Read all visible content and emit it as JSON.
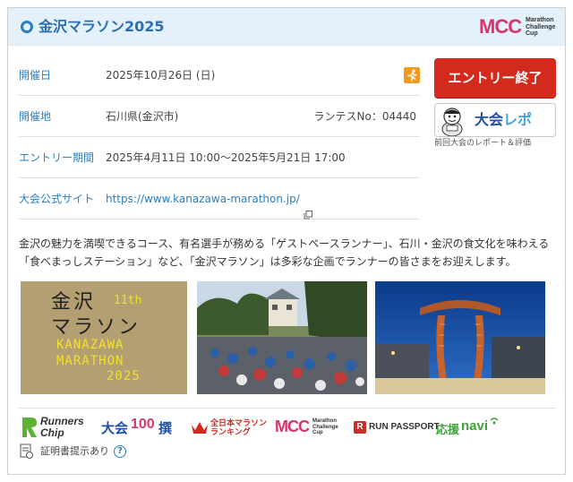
{
  "header": {
    "title": "金沢マラソン2025",
    "mcc_logo_big": "MCC",
    "mcc_logo_small": [
      "Marathon",
      "Challenge",
      "Cup"
    ]
  },
  "info": [
    {
      "label": "開催日",
      "value": "2025年10月26日 (日)",
      "icon": "runner-icon"
    },
    {
      "label": "開催地",
      "value": "石川県(金沢市)",
      "right": "ランテスNo：04440"
    },
    {
      "label": "エントリー期間",
      "value": "2025年4月11日 10:00〜2025年5月21日 17:00"
    },
    {
      "label": "大会公式サイト",
      "value": "https://www.kanazawa-marathon.jp/",
      "icon": "external-link-icon"
    }
  ],
  "entry_button": {
    "label": "エントリー終了"
  },
  "report_button": {
    "label_part1": "大会",
    "label_part2": "レポ",
    "caption": "前回大会のレポート＆評価"
  },
  "description": "金沢の魅力を満喫できるコース、有名選手が務める「ゲストペースランナー」、石川・金沢の食文化を味わえる「食べまっしステーション」など、「金沢マラソン」は多彩な企画でランナーの皆さまをお迎えします。",
  "poster": {
    "ja_line1": "金沢",
    "ja_line2": "マラソン",
    "edition": "11th",
    "en_line1": "KANAZAWA",
    "en_line2": "MARATHON",
    "year": "2025"
  },
  "logos": {
    "runners_chip": [
      "Runners",
      "Chip"
    ],
    "taikai100": [
      "大会",
      "100",
      "撰"
    ],
    "ranking": [
      "全日本マラソン",
      "ランキング"
    ],
    "mcc": "MCC",
    "mcc_small": [
      "Marathon",
      "Challenge",
      "Cup"
    ],
    "run_passport": "RUN PASSPORT",
    "ouen_navi": [
      "応援",
      "navi"
    ]
  },
  "certificate": {
    "text": "証明書提示あり",
    "help": "?"
  },
  "colors": {
    "accent": "#2a7fc2",
    "entry": "#d42a1e",
    "header_bg": "#e5f1fa",
    "runner_badge": "#f19a1e"
  }
}
